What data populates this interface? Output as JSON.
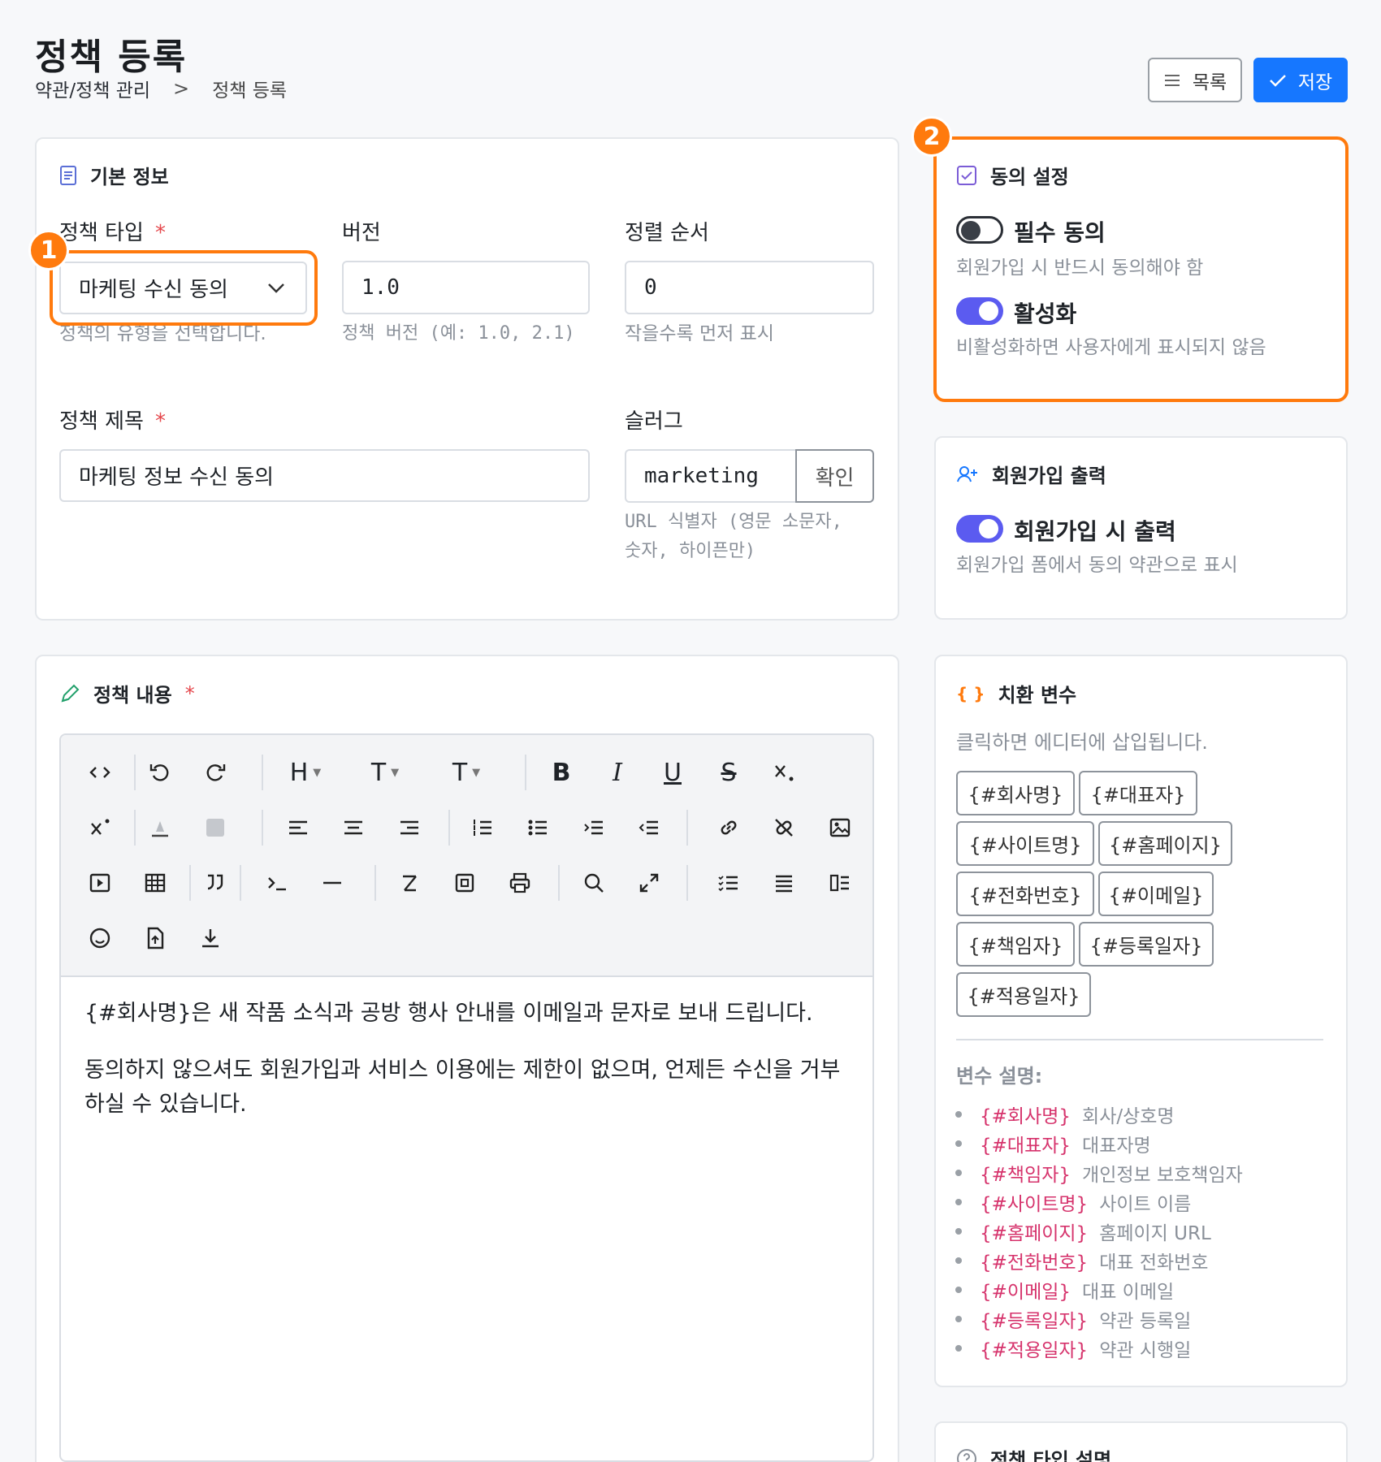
{
  "header": {
    "title": "정책 등록",
    "breadcrumb": [
      "약관/정책 관리",
      "정책 등록"
    ],
    "list_button": "목록",
    "save_button": "저장"
  },
  "basic_info": {
    "title": "기본 정보",
    "policy_type": {
      "label": "정책 타입",
      "required": "*",
      "value": "마케팅 수신 동의",
      "help": "정책의 유형을 선택합니다."
    },
    "version": {
      "label": "버전",
      "value": "1.0",
      "help": "정책 버전 (예: 1.0, 2.1)"
    },
    "sort_order": {
      "label": "정렬 순서",
      "value": "0",
      "help": "작을수록 먼저 표시"
    },
    "policy_title": {
      "label": "정책 제목",
      "required": "*",
      "value": "마케팅 정보 수신 동의"
    },
    "slug": {
      "label": "슬러그",
      "value": "marketing",
      "check_button": "확인",
      "help": "URL 식별자 (영문 소문자, 숫자, 하이픈만)"
    }
  },
  "annotations": {
    "badge1": "1",
    "badge2": "2"
  },
  "consent": {
    "title": "동의 설정",
    "required_toggle": {
      "label": "필수 동의",
      "on": false,
      "help": "회원가입 시 반드시 동의해야 함"
    },
    "active_toggle": {
      "label": "활성화",
      "on": true,
      "help": "비활성화하면 사용자에게 표시되지 않음"
    }
  },
  "signup_output": {
    "title": "회원가입 출력",
    "toggle": {
      "label": "회원가입 시 출력",
      "on": true,
      "help": "회원가입 폼에서 동의 약관으로 표시"
    }
  },
  "content": {
    "title": "정책 내용",
    "required": "*",
    "toolbar": {
      "heading": "H",
      "font_size": "T",
      "font_family": "T",
      "bold": "B",
      "italic": "I",
      "underline": "U",
      "strike": "S"
    },
    "paragraphs": [
      "{#회사명}은 새 작품 소식과 공방 행사 안내를 이메일과 문자로 보내 드립니다.",
      "동의하지 않으셔도 회원가입과 서비스 이용에는 제한이 없으며, 언제든 수신을 거부하실 수 있습니다."
    ]
  },
  "variables": {
    "title": "치환 변수",
    "hint": "클릭하면 에디터에 삽입됩니다.",
    "chips": [
      "{#회사명}",
      "{#대표자}",
      "{#사이트명}",
      "{#홈페이지}",
      "{#전화번호}",
      "{#이메일}",
      "{#책임자}",
      "{#등록일자}",
      "{#적용일자}"
    ],
    "desc_title": "변수 설명:",
    "descriptions": [
      {
        "code": "{#회사명}",
        "text": "회사/상호명"
      },
      {
        "code": "{#대표자}",
        "text": "대표자명"
      },
      {
        "code": "{#책임자}",
        "text": "개인정보 보호책임자"
      },
      {
        "code": "{#사이트명}",
        "text": "사이트 이름"
      },
      {
        "code": "{#홈페이지}",
        "text": "홈페이지 URL"
      },
      {
        "code": "{#전화번호}",
        "text": "대표 전화번호"
      },
      {
        "code": "{#이메일}",
        "text": "대표 이메일"
      },
      {
        "code": "{#등록일자}",
        "text": "약관 등록일"
      },
      {
        "code": "{#적용일자}",
        "text": "약관 시행일"
      }
    ]
  },
  "policy_type_help": {
    "title": "정책 타입 설명"
  },
  "colors": {
    "primary": "#1677ff",
    "highlight": "#ff7a0d",
    "toggle_on": "#5b5bf0",
    "required": "#e5484d",
    "var_code": "#d6336c"
  }
}
